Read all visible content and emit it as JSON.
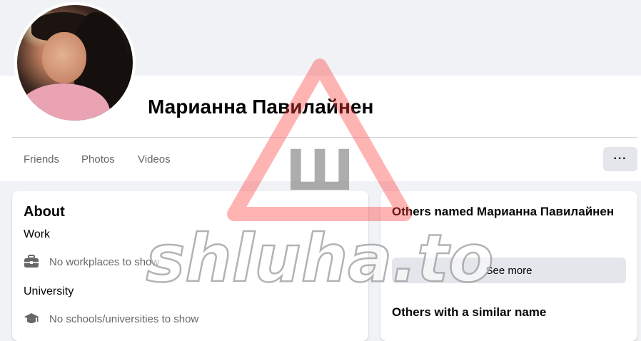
{
  "profile": {
    "name": "Марианна Павилайнен",
    "avatar_icon": "profile-photo"
  },
  "nav": {
    "tabs": [
      {
        "label": "Friends"
      },
      {
        "label": "Photos"
      },
      {
        "label": "Videos"
      }
    ],
    "more_label": "···"
  },
  "about": {
    "title": "About",
    "work": {
      "heading": "Work",
      "text": "No workplaces to show",
      "icon": "briefcase-icon"
    },
    "university": {
      "heading": "University",
      "text": "No schools/universities to show",
      "icon": "graduation-cap-icon"
    }
  },
  "sidebar": {
    "others_named_title": "Others named Марианна Павилайнен",
    "see_more_label": "See more",
    "similar_title": "Others with a similar name"
  },
  "watermark": {
    "text": "shluha.to",
    "glyph": "Ш"
  },
  "colors": {
    "background": "#f0f2f5",
    "secondary_text": "#65676b",
    "button_bg": "#e4e6eb",
    "watermark_red": "#ff3b3b"
  }
}
